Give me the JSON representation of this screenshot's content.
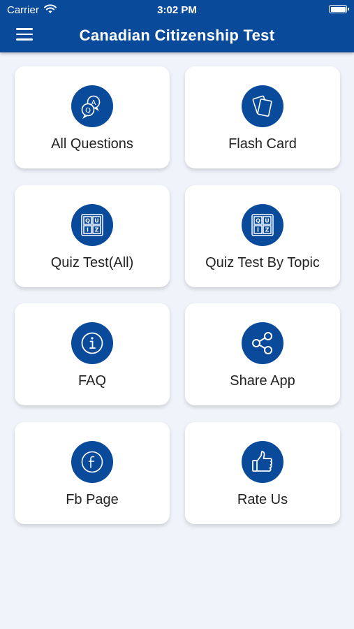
{
  "status_bar": {
    "carrier": "Carrier",
    "time": "3:02 PM"
  },
  "header": {
    "title": "Canadian Citizenship Test",
    "menu_icon": "hamburger-menu-icon"
  },
  "colors": {
    "primary": "#0a4a9a",
    "background": "#f1f3fb",
    "card": "#ffffff"
  },
  "menu": {
    "items": [
      {
        "label": "All Questions",
        "icon": "questions-chat-icon"
      },
      {
        "label": "Flash Card",
        "icon": "flash-card-icon"
      },
      {
        "label": "Quiz Test(All)",
        "icon": "quiz-grid-icon"
      },
      {
        "label": "Quiz Test By Topic",
        "icon": "quiz-grid-icon"
      },
      {
        "label": "FAQ",
        "icon": "info-icon"
      },
      {
        "label": "Share App",
        "icon": "share-icon"
      },
      {
        "label": "Fb Page",
        "icon": "facebook-icon"
      },
      {
        "label": "Rate Us",
        "icon": "thumbs-up-icon"
      }
    ]
  }
}
